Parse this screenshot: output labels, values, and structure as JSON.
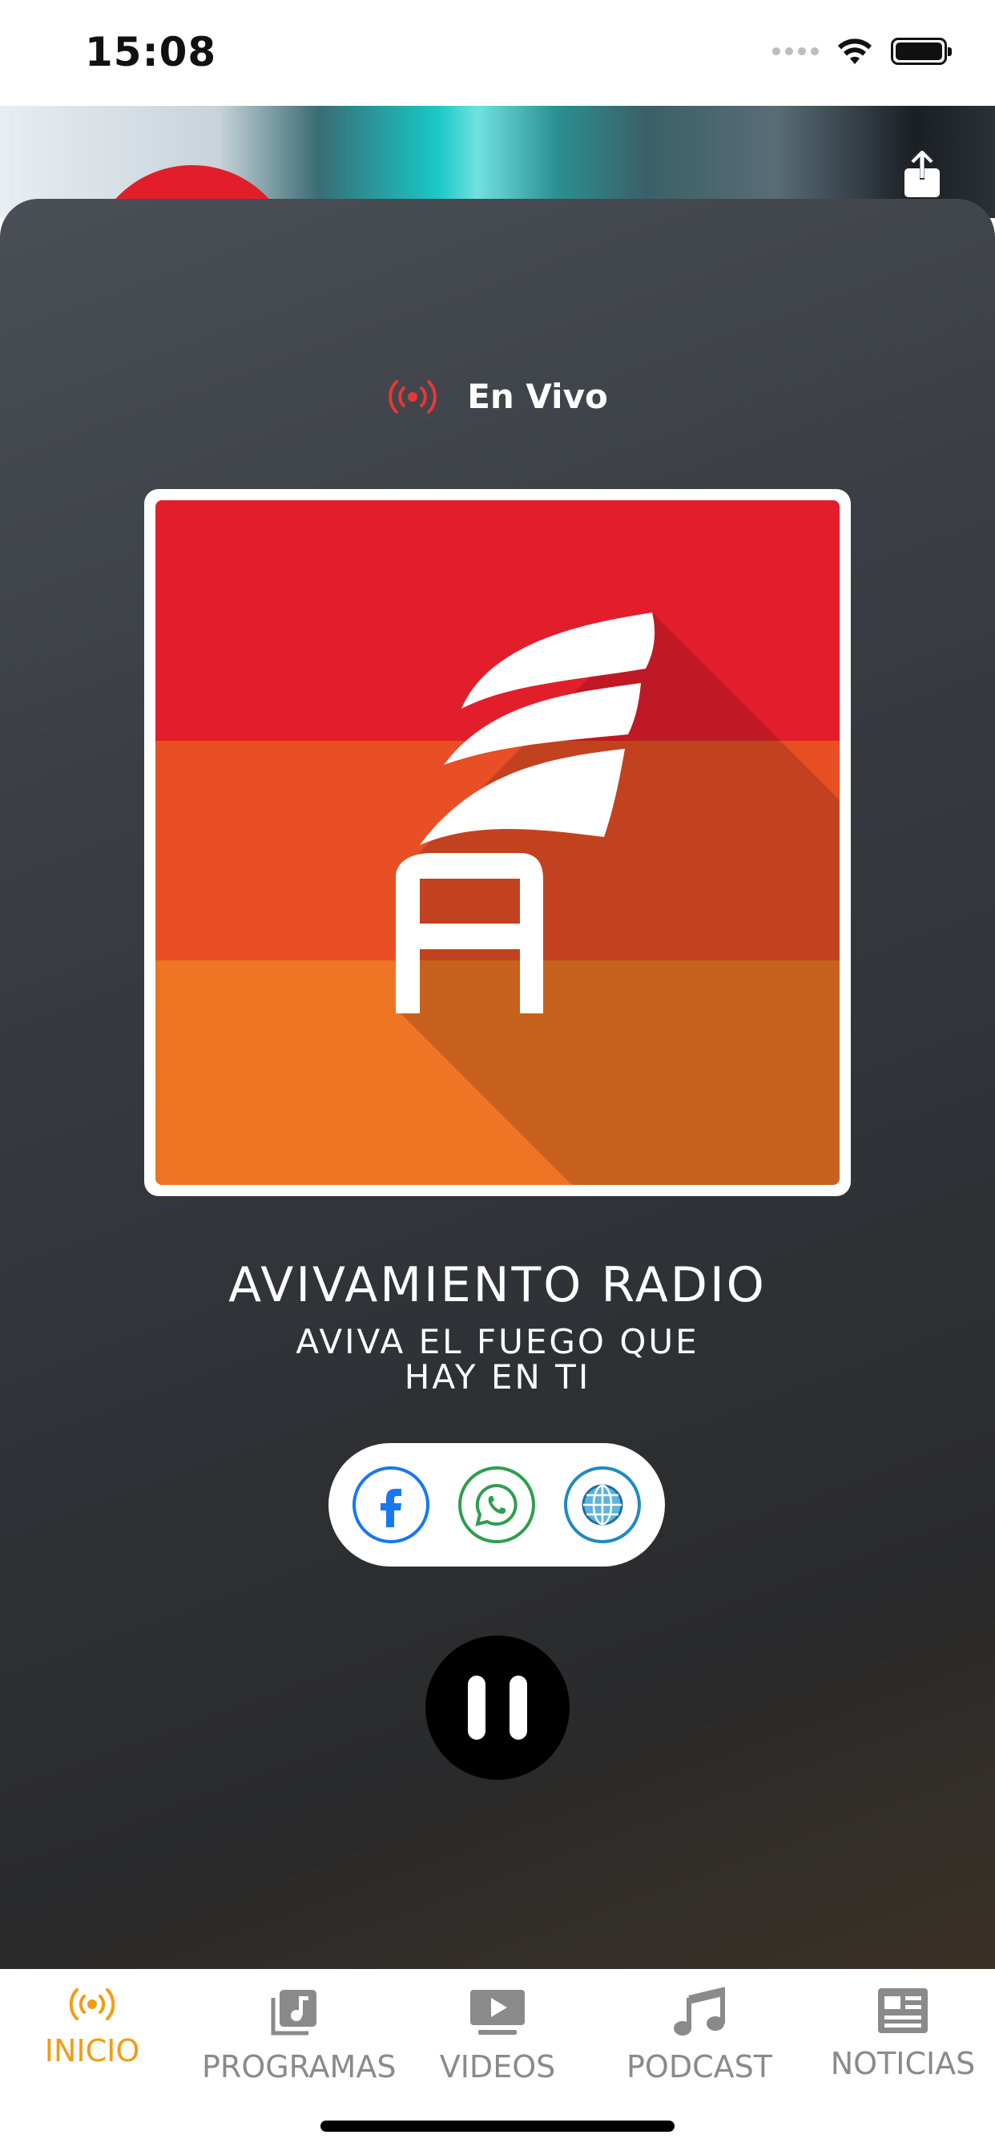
{
  "status_bar": {
    "time": "15:08"
  },
  "player": {
    "live_label": "En Vivo",
    "station_name": "AVIVAMIENTO RADIO",
    "slogan": "AVIVA EL FUEGO QUE HAY EN TI",
    "state": "playing"
  },
  "social": [
    {
      "name": "facebook",
      "color": "#1877f2"
    },
    {
      "name": "whatsapp",
      "color": "#2e9e4f"
    },
    {
      "name": "website",
      "color": "#1f8ac0"
    }
  ],
  "colors": {
    "accent": "#f39c12",
    "live_red": "#e53935",
    "tab_inactive": "#8a8a8a",
    "cover_band_1": "#e31e2b",
    "cover_band_2": "#e84f25",
    "cover_band_3": "#ee7524"
  },
  "tabs": [
    {
      "label": "INICIO",
      "icon": "broadcast-icon",
      "active": true
    },
    {
      "label": "PROGRAMAS",
      "icon": "music-library-icon",
      "active": false
    },
    {
      "label": "VIDEOS",
      "icon": "video-icon",
      "active": false
    },
    {
      "label": "PODCAST",
      "icon": "music-note-icon",
      "active": false
    },
    {
      "label": "NOTICIAS",
      "icon": "newspaper-icon",
      "active": false
    }
  ]
}
